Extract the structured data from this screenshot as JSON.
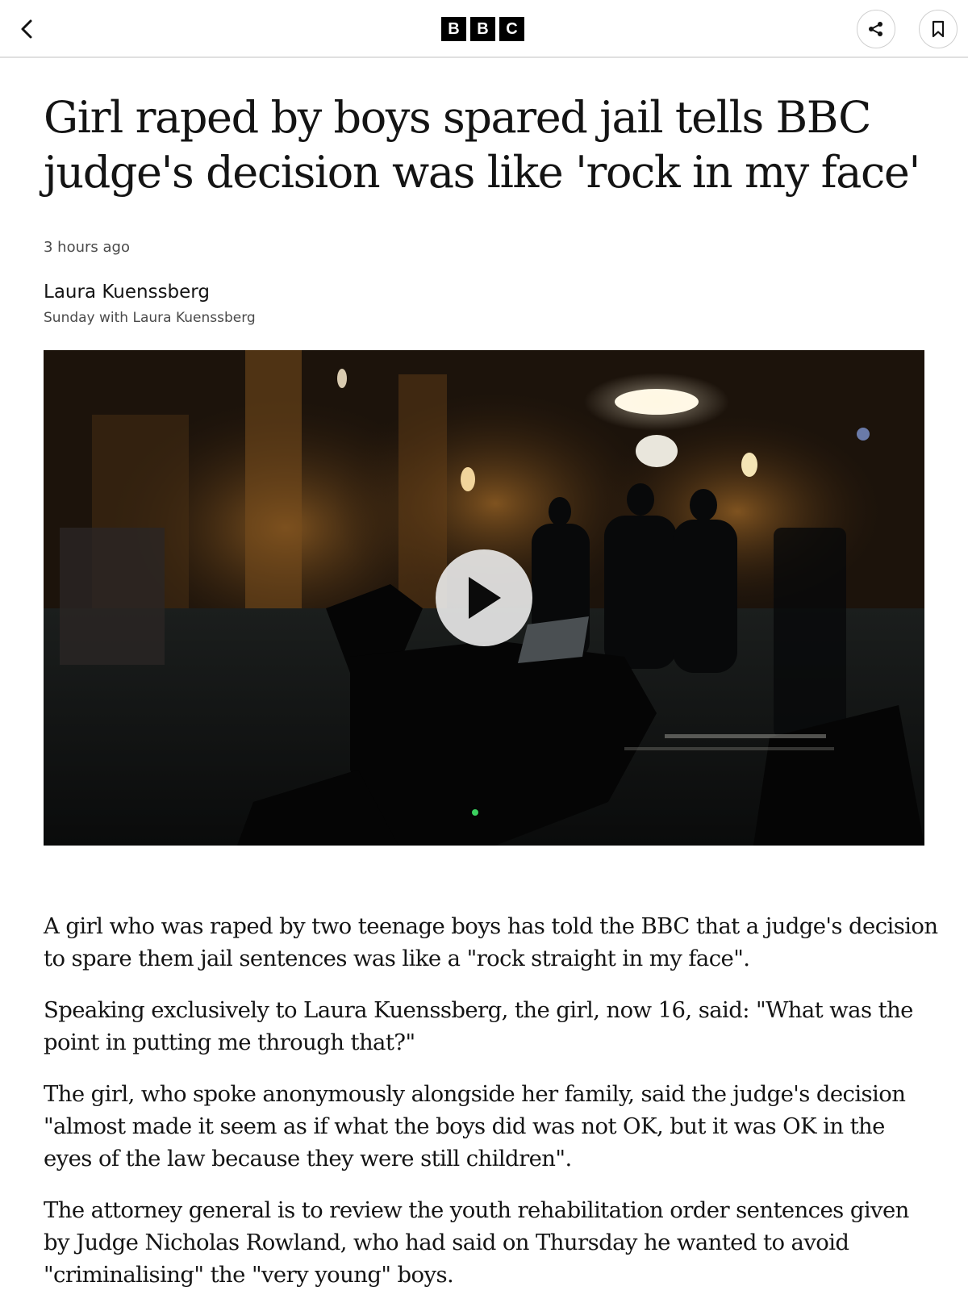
{
  "header": {
    "logo_letters": [
      "B",
      "B",
      "C"
    ]
  },
  "article": {
    "headline": "Girl raped by boys spared jail tells BBC judge's decision was like 'rock in my face'",
    "timestamp": "3 hours ago",
    "author": "Laura Kuenssberg",
    "author_show": "Sunday with Laura Kuenssberg",
    "paragraphs": [
      "A girl who was raped by two teenage boys has told the BBC that a judge's decision to spare them jail sentences was like a \"rock straight in my face\".",
      "Speaking exclusively to Laura Kuenssberg, the girl, now 16, said: \"What was the point in putting me through that?\"",
      "The girl, who spoke anonymously alongside her family, said the judge's decision \"almost made it seem as if what the boys did was not OK, but it was OK in the eyes of the law because they were still children\".",
      "The attorney general is to review the youth rehabilitation order sentences given by Judge Nicholas Rowland, who had said on Thursday he wanted to avoid \"criminalising\" the \"very young\" boys."
    ]
  },
  "icons": {
    "back": "chevron-left-icon",
    "share": "share-icon",
    "bookmark": "bookmark-icon",
    "play": "play-icon"
  },
  "colors": {
    "text": "#141414",
    "meta": "#4a4a4a",
    "divider": "#e0e0e0"
  }
}
